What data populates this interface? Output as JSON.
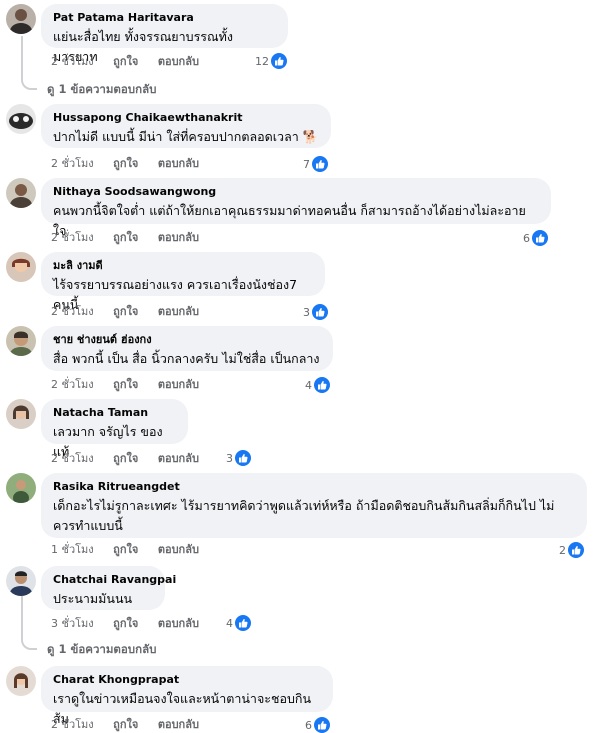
{
  "actions": {
    "like": "ถูกใจ",
    "reply": "ตอบกลับ"
  },
  "colors": {
    "like_blue": "#1877f2",
    "bubble_bg": "#f0f2f5",
    "meta_gray": "#65676b"
  },
  "reply_link": "ดู 1 ข้อความตอบกลับ",
  "comments": [
    {
      "author": "Pat Patama Haritavara",
      "text": "แย่นะสื่อไทย ทั้งจรรณยาบรรณทั้งมารยาท",
      "time": "2 ชั่วโมง",
      "reactions": "12"
    },
    {
      "author": "Hussapong Chaikaewthanakrit",
      "text": "ปากไม่ดี แบบนี้ มีน่า ใส่ที่ครอบปากตลอดเวลา 🐕",
      "time": "2 ชั่วโมง",
      "reactions": "7"
    },
    {
      "author": "Nithaya Soodsawangwong",
      "text": "คนพวกนี้จิตใจต่ำ แต่ถ้าให้ยกเอาคุณธรรมมาด่าทอคนอื่น ก็สามารถอ้างได้อย่างไม่ละอายใจ",
      "time": "2 ชั่วโมง",
      "reactions": "6"
    },
    {
      "author": "มะลิ งามดี",
      "text": "ไร้จรรยาบรรณอย่างแรง ควรเอาเรื่องนังช่อง7 คนนี้",
      "time": "2 ชั่วโมง",
      "reactions": "3"
    },
    {
      "author": "ชาย ช่างยนต์ ฮ่องกง",
      "text": "สื่อ พวกนี้ เป็น สื่อ นิ้วกลางครับ ไม่ใช่สื่อ เป็นกลาง",
      "time": "2 ชั่วโมง",
      "reactions": "4"
    },
    {
      "author": "Natacha Taman",
      "text": "เลวมาก จรัญไร ของแท้",
      "time": "2 ชั่วโมง",
      "reactions": "3"
    },
    {
      "author": "Rasika Ritrueangdet",
      "text": "เด็กอะไรไม่รูกาละเทศะ ไร้มารยาทคิดว่าพูดแล้วเท่ห์หรือ ถ้ามือดติชอบกินส้มกินสลิ่มก็กินไป ไม่ควรทำแบบนี้",
      "time": "1 ชั่วโมง",
      "reactions": "2"
    },
    {
      "author": "Chatchai Ravangpai",
      "text": "ประนามมันนน",
      "time": "3 ชั่วโมง",
      "reactions": "4"
    },
    {
      "author": "Charat Khongprapat",
      "text": "เราดูในข่าวเหมือนจงใจและหน้าตาน่าจะชอบกินส้ม",
      "time": "2 ชั่วโมง",
      "reactions": "6"
    }
  ]
}
